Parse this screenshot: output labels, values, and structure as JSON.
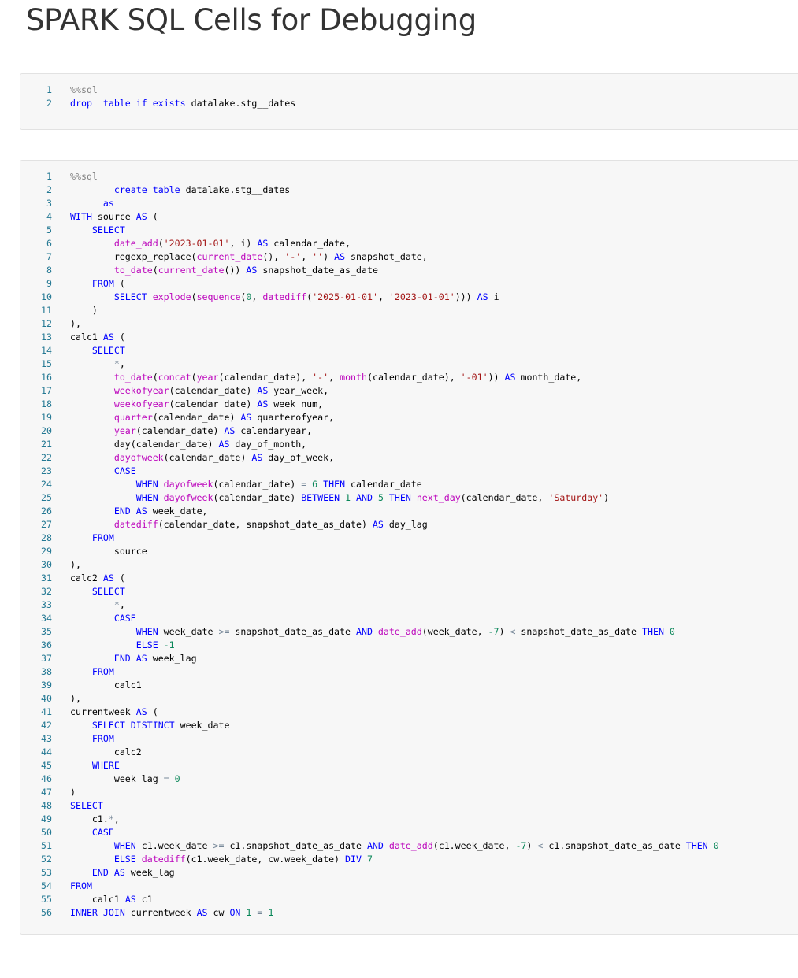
{
  "title": "SPARK SQL Cells for Debugging",
  "colors": {
    "keyword": "#0000ff",
    "function": "#bc05bc",
    "string": "#a31515",
    "number": "#098658",
    "operator": "#778899",
    "line_number": "#237893",
    "cell_background": "#f7f7f7"
  },
  "cells": [
    {
      "lines": [
        [
          [
            "mg",
            "%%sql"
          ]
        ],
        [
          [
            "kw",
            "drop"
          ],
          [
            "",
            "  "
          ],
          [
            "kw",
            "table"
          ],
          [
            "",
            " "
          ],
          [
            "kw",
            "if"
          ],
          [
            "",
            " "
          ],
          [
            "kw",
            "exists"
          ],
          [
            "",
            " datalake.stg__dates"
          ]
        ]
      ]
    },
    {
      "lines": [
        [
          [
            "mg",
            "%%sql"
          ]
        ],
        [
          [
            "",
            "        "
          ],
          [
            "kw",
            "create"
          ],
          [
            "",
            " "
          ],
          [
            "kw",
            "table"
          ],
          [
            "",
            " datalake.stg__dates"
          ]
        ],
        [
          [
            "",
            "      "
          ],
          [
            "kw",
            "as"
          ]
        ],
        [
          [
            "kw",
            "WITH"
          ],
          [
            "",
            " source "
          ],
          [
            "kw",
            "AS"
          ],
          [
            "",
            " ("
          ]
        ],
        [
          [
            "",
            "    "
          ],
          [
            "kw",
            "SELECT"
          ]
        ],
        [
          [
            "",
            "        "
          ],
          [
            "fn",
            "date_add"
          ],
          [
            "",
            "("
          ],
          [
            "str",
            "'2023-01-01'"
          ],
          [
            "",
            ", i) "
          ],
          [
            "kw",
            "AS"
          ],
          [
            "",
            " calendar_date,"
          ]
        ],
        [
          [
            "",
            "        regexp_replace("
          ],
          [
            "fn",
            "current_date"
          ],
          [
            "",
            "(), "
          ],
          [
            "str",
            "'-'"
          ],
          [
            "",
            ", "
          ],
          [
            "str",
            "''"
          ],
          [
            "",
            ") "
          ],
          [
            "kw",
            "AS"
          ],
          [
            "",
            " snapshot_date,"
          ]
        ],
        [
          [
            "",
            "        "
          ],
          [
            "fn",
            "to_date"
          ],
          [
            "",
            "("
          ],
          [
            "fn",
            "current_date"
          ],
          [
            "",
            "()) "
          ],
          [
            "kw",
            "AS"
          ],
          [
            "",
            " snapshot_date_as_date"
          ]
        ],
        [
          [
            "",
            "    "
          ],
          [
            "kw",
            "FROM"
          ],
          [
            "",
            " ("
          ]
        ],
        [
          [
            "",
            "        "
          ],
          [
            "kw",
            "SELECT"
          ],
          [
            "",
            " "
          ],
          [
            "fn",
            "explode"
          ],
          [
            "",
            "("
          ],
          [
            "fn",
            "sequence"
          ],
          [
            "",
            "("
          ],
          [
            "num",
            "0"
          ],
          [
            "",
            ", "
          ],
          [
            "fn",
            "datediff"
          ],
          [
            "",
            "("
          ],
          [
            "str",
            "'2025-01-01'"
          ],
          [
            "",
            ", "
          ],
          [
            "str",
            "'2023-01-01'"
          ],
          [
            "",
            ")))"
          ],
          [
            "",
            " "
          ],
          [
            "kw",
            "AS"
          ],
          [
            "",
            " i"
          ]
        ],
        [
          [
            "",
            "    )"
          ]
        ],
        [
          [
            "",
            "),"
          ]
        ],
        [
          [
            "",
            "calc1 "
          ],
          [
            "kw",
            "AS"
          ],
          [
            "",
            " ("
          ]
        ],
        [
          [
            "",
            "    "
          ],
          [
            "kw",
            "SELECT"
          ]
        ],
        [
          [
            "",
            "        "
          ],
          [
            "op",
            "*"
          ],
          [
            "",
            ","
          ]
        ],
        [
          [
            "",
            "        "
          ],
          [
            "fn",
            "to_date"
          ],
          [
            "",
            "("
          ],
          [
            "fn",
            "concat"
          ],
          [
            "",
            "("
          ],
          [
            "fn",
            "year"
          ],
          [
            "",
            "(calendar_date), "
          ],
          [
            "str",
            "'-'"
          ],
          [
            "",
            ", "
          ],
          [
            "fn",
            "month"
          ],
          [
            "",
            "(calendar_date), "
          ],
          [
            "str",
            "'-01'"
          ],
          [
            "",
            ")) "
          ],
          [
            "kw",
            "AS"
          ],
          [
            "",
            " month_date,"
          ]
        ],
        [
          [
            "",
            "        "
          ],
          [
            "fn",
            "weekofyear"
          ],
          [
            "",
            "(calendar_date) "
          ],
          [
            "kw",
            "AS"
          ],
          [
            "",
            " year_week,"
          ]
        ],
        [
          [
            "",
            "        "
          ],
          [
            "fn",
            "weekofyear"
          ],
          [
            "",
            "(calendar_date) "
          ],
          [
            "kw",
            "AS"
          ],
          [
            "",
            " week_num,"
          ]
        ],
        [
          [
            "",
            "        "
          ],
          [
            "fn",
            "quarter"
          ],
          [
            "",
            "(calendar_date) "
          ],
          [
            "kw",
            "AS"
          ],
          [
            "",
            " quarterofyear,"
          ]
        ],
        [
          [
            "",
            "        "
          ],
          [
            "fn",
            "year"
          ],
          [
            "",
            "(calendar_date) "
          ],
          [
            "kw",
            "AS"
          ],
          [
            "",
            " calendaryear,"
          ]
        ],
        [
          [
            "",
            "        day(calendar_date) "
          ],
          [
            "kw",
            "AS"
          ],
          [
            "",
            " day_of_month,"
          ]
        ],
        [
          [
            "",
            "        "
          ],
          [
            "fn",
            "dayofweek"
          ],
          [
            "",
            "(calendar_date) "
          ],
          [
            "kw",
            "AS"
          ],
          [
            "",
            " day_of_week,"
          ]
        ],
        [
          [
            "",
            "        "
          ],
          [
            "kw",
            "CASE"
          ]
        ],
        [
          [
            "",
            "            "
          ],
          [
            "kw",
            "WHEN"
          ],
          [
            "",
            " "
          ],
          [
            "fn",
            "dayofweek"
          ],
          [
            "",
            "(calendar_date) "
          ],
          [
            "op",
            "="
          ],
          [
            "",
            " "
          ],
          [
            "num",
            "6"
          ],
          [
            "",
            " "
          ],
          [
            "kw",
            "THEN"
          ],
          [
            "",
            " calendar_date"
          ]
        ],
        [
          [
            "",
            "            "
          ],
          [
            "kw",
            "WHEN"
          ],
          [
            "",
            " "
          ],
          [
            "fn",
            "dayofweek"
          ],
          [
            "",
            "(calendar_date) "
          ],
          [
            "kw",
            "BETWEEN"
          ],
          [
            "",
            " "
          ],
          [
            "num",
            "1"
          ],
          [
            "",
            " "
          ],
          [
            "kw",
            "AND"
          ],
          [
            "",
            " "
          ],
          [
            "num",
            "5"
          ],
          [
            "",
            " "
          ],
          [
            "kw",
            "THEN"
          ],
          [
            "",
            " "
          ],
          [
            "fn",
            "next_day"
          ],
          [
            "",
            "(calendar_date, "
          ],
          [
            "str",
            "'Saturday'"
          ],
          [
            "",
            ")"
          ]
        ],
        [
          [
            "",
            "        "
          ],
          [
            "kw",
            "END"
          ],
          [
            "",
            " "
          ],
          [
            "kw",
            "AS"
          ],
          [
            "",
            " week_date,"
          ]
        ],
        [
          [
            "",
            "        "
          ],
          [
            "fn",
            "datediff"
          ],
          [
            "",
            "(calendar_date, snapshot_date_as_date) "
          ],
          [
            "kw",
            "AS"
          ],
          [
            "",
            " day_lag"
          ]
        ],
        [
          [
            "",
            "    "
          ],
          [
            "kw",
            "FROM"
          ]
        ],
        [
          [
            "",
            "        source"
          ]
        ],
        [
          [
            "",
            "),"
          ]
        ],
        [
          [
            "",
            "calc2 "
          ],
          [
            "kw",
            "AS"
          ],
          [
            "",
            " ("
          ]
        ],
        [
          [
            "",
            "    "
          ],
          [
            "kw",
            "SELECT"
          ]
        ],
        [
          [
            "",
            "        "
          ],
          [
            "op",
            "*"
          ],
          [
            "",
            ","
          ]
        ],
        [
          [
            "",
            "        "
          ],
          [
            "kw",
            "CASE"
          ]
        ],
        [
          [
            "",
            "            "
          ],
          [
            "kw",
            "WHEN"
          ],
          [
            "",
            " week_date "
          ],
          [
            "op",
            ">="
          ],
          [
            "",
            " snapshot_date_as_date "
          ],
          [
            "kw",
            "AND"
          ],
          [
            "",
            " "
          ],
          [
            "fn",
            "date_add"
          ],
          [
            "",
            "(week_date, "
          ],
          [
            "num",
            "-7"
          ],
          [
            "",
            ") "
          ],
          [
            "op",
            "<"
          ],
          [
            "",
            " snapshot_date_as_date "
          ],
          [
            "kw",
            "THEN"
          ],
          [
            "",
            " "
          ],
          [
            "num",
            "0"
          ]
        ],
        [
          [
            "",
            "            "
          ],
          [
            "kw",
            "ELSE"
          ],
          [
            "",
            " "
          ],
          [
            "num",
            "-1"
          ]
        ],
        [
          [
            "",
            "        "
          ],
          [
            "kw",
            "END"
          ],
          [
            "",
            " "
          ],
          [
            "kw",
            "AS"
          ],
          [
            "",
            " week_lag"
          ]
        ],
        [
          [
            "",
            "    "
          ],
          [
            "kw",
            "FROM"
          ]
        ],
        [
          [
            "",
            "        calc1"
          ]
        ],
        [
          [
            "",
            "),"
          ]
        ],
        [
          [
            "",
            "currentweek "
          ],
          [
            "kw",
            "AS"
          ],
          [
            "",
            " ("
          ]
        ],
        [
          [
            "",
            "    "
          ],
          [
            "kw",
            "SELECT"
          ],
          [
            "",
            " "
          ],
          [
            "kw",
            "DISTINCT"
          ],
          [
            "",
            " week_date"
          ]
        ],
        [
          [
            "",
            "    "
          ],
          [
            "kw",
            "FROM"
          ]
        ],
        [
          [
            "",
            "        calc2"
          ]
        ],
        [
          [
            "",
            "    "
          ],
          [
            "kw",
            "WHERE"
          ]
        ],
        [
          [
            "",
            "        week_lag "
          ],
          [
            "op",
            "="
          ],
          [
            "",
            " "
          ],
          [
            "num",
            "0"
          ]
        ],
        [
          [
            "",
            ")"
          ]
        ],
        [
          [
            "kw",
            "SELECT"
          ]
        ],
        [
          [
            "",
            "    c1."
          ],
          [
            "op",
            "*"
          ],
          [
            "",
            ","
          ]
        ],
        [
          [
            "",
            "    "
          ],
          [
            "kw",
            "CASE"
          ]
        ],
        [
          [
            "",
            "        "
          ],
          [
            "kw",
            "WHEN"
          ],
          [
            "",
            " c1.week_date "
          ],
          [
            "op",
            ">="
          ],
          [
            "",
            " c1.snapshot_date_as_date "
          ],
          [
            "kw",
            "AND"
          ],
          [
            "",
            " "
          ],
          [
            "fn",
            "date_add"
          ],
          [
            "",
            "(c1.week_date, "
          ],
          [
            "num",
            "-7"
          ],
          [
            "",
            ") "
          ],
          [
            "op",
            "<"
          ],
          [
            "",
            " c1.snapshot_date_as_date "
          ],
          [
            "kw",
            "THEN"
          ],
          [
            "",
            " "
          ],
          [
            "num",
            "0"
          ]
        ],
        [
          [
            "",
            "        "
          ],
          [
            "kw",
            "ELSE"
          ],
          [
            "",
            " "
          ],
          [
            "fn",
            "datediff"
          ],
          [
            "",
            "(c1.week_date, cw.week_date) "
          ],
          [
            "kw",
            "DIV"
          ],
          [
            "",
            " "
          ],
          [
            "num",
            "7"
          ]
        ],
        [
          [
            "",
            "    "
          ],
          [
            "kw",
            "END"
          ],
          [
            "",
            " "
          ],
          [
            "kw",
            "AS"
          ],
          [
            "",
            " week_lag"
          ]
        ],
        [
          [
            "kw",
            "FROM"
          ]
        ],
        [
          [
            "",
            "    calc1 "
          ],
          [
            "kw",
            "AS"
          ],
          [
            "",
            " c1"
          ]
        ],
        [
          [
            "kw",
            "INNER"
          ],
          [
            "",
            " "
          ],
          [
            "kw",
            "JOIN"
          ],
          [
            "",
            " currentweek "
          ],
          [
            "kw",
            "AS"
          ],
          [
            "",
            " cw "
          ],
          [
            "kw",
            "ON"
          ],
          [
            "",
            " "
          ],
          [
            "num",
            "1"
          ],
          [
            "",
            " "
          ],
          [
            "op",
            "="
          ],
          [
            "",
            " "
          ],
          [
            "num",
            "1"
          ]
        ]
      ]
    }
  ]
}
